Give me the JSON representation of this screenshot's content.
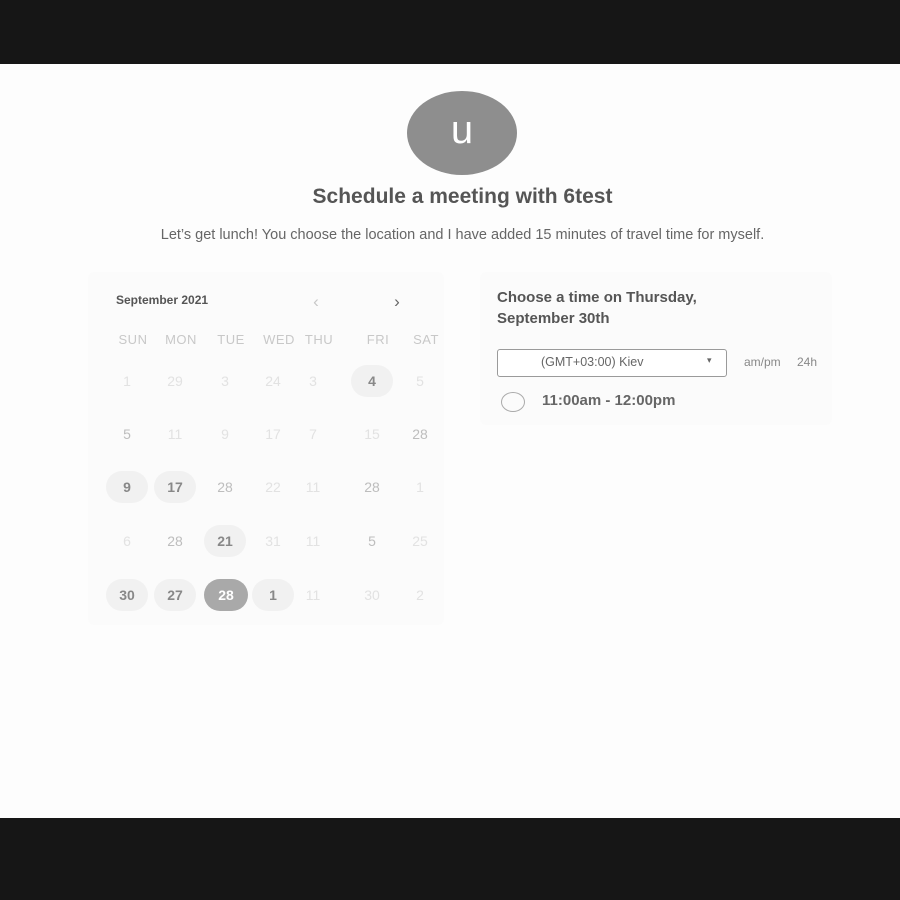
{
  "header": {
    "avatar_letter": "u",
    "title": "Schedule a meeting with 6test",
    "description": "Let’s get lunch! You choose the location and I have added 15 minutes of travel time for myself."
  },
  "calendar": {
    "month_label": "September 2021",
    "prev_icon": "‹",
    "next_icon": "›",
    "weekdays": [
      "SUN",
      "MON",
      "TUE",
      "WED",
      "THU",
      "FRI",
      "SAT"
    ],
    "weeks": [
      [
        {
          "label": "1",
          "state": "faded"
        },
        {
          "label": "29",
          "state": "faded"
        },
        {
          "label": "3",
          "state": "faded"
        },
        {
          "label": "24",
          "state": "faded"
        },
        {
          "label": "3",
          "state": "faded"
        },
        {
          "label": "4",
          "state": "available"
        },
        {
          "label": "5",
          "state": "faded"
        }
      ],
      [
        {
          "label": "5",
          "state": "muted"
        },
        {
          "label": "11",
          "state": "faded"
        },
        {
          "label": "9",
          "state": "faded"
        },
        {
          "label": "17",
          "state": "faded"
        },
        {
          "label": "7",
          "state": "faded"
        },
        {
          "label": "15",
          "state": "faded"
        },
        {
          "label": "28",
          "state": "muted"
        }
      ],
      [
        {
          "label": "9",
          "state": "available"
        },
        {
          "label": "17",
          "state": "available"
        },
        {
          "label": "28",
          "state": "muted"
        },
        {
          "label": "22",
          "state": "faded"
        },
        {
          "label": "11",
          "state": "faded"
        },
        {
          "label": "28",
          "state": "muted"
        },
        {
          "label": "1",
          "state": "faded"
        }
      ],
      [
        {
          "label": "6",
          "state": "faded"
        },
        {
          "label": "28",
          "state": "muted"
        },
        {
          "label": "21",
          "state": "available"
        },
        {
          "label": "31",
          "state": "faded"
        },
        {
          "label": "11",
          "state": "faded"
        },
        {
          "label": "5",
          "state": "muted"
        },
        {
          "label": "25",
          "state": "faded"
        }
      ],
      [
        {
          "label": "30",
          "state": "available"
        },
        {
          "label": "27",
          "state": "available"
        },
        {
          "label": "28",
          "state": "selected"
        },
        {
          "label": "1",
          "state": "available"
        },
        {
          "label": "11",
          "state": "faded"
        },
        {
          "label": "30",
          "state": "faded"
        },
        {
          "label": "2",
          "state": "faded"
        }
      ]
    ]
  },
  "time_panel": {
    "heading_line1": "Choose a time on Thursday,",
    "heading_line2": "September 30th",
    "timezone_value": "(GMT+03:00) Kiev",
    "timezone_caret": "▾",
    "format_ampm": "am/pm",
    "format_24h": "24h",
    "slots": [
      {
        "label": "11:00am - 12:00pm"
      }
    ]
  }
}
